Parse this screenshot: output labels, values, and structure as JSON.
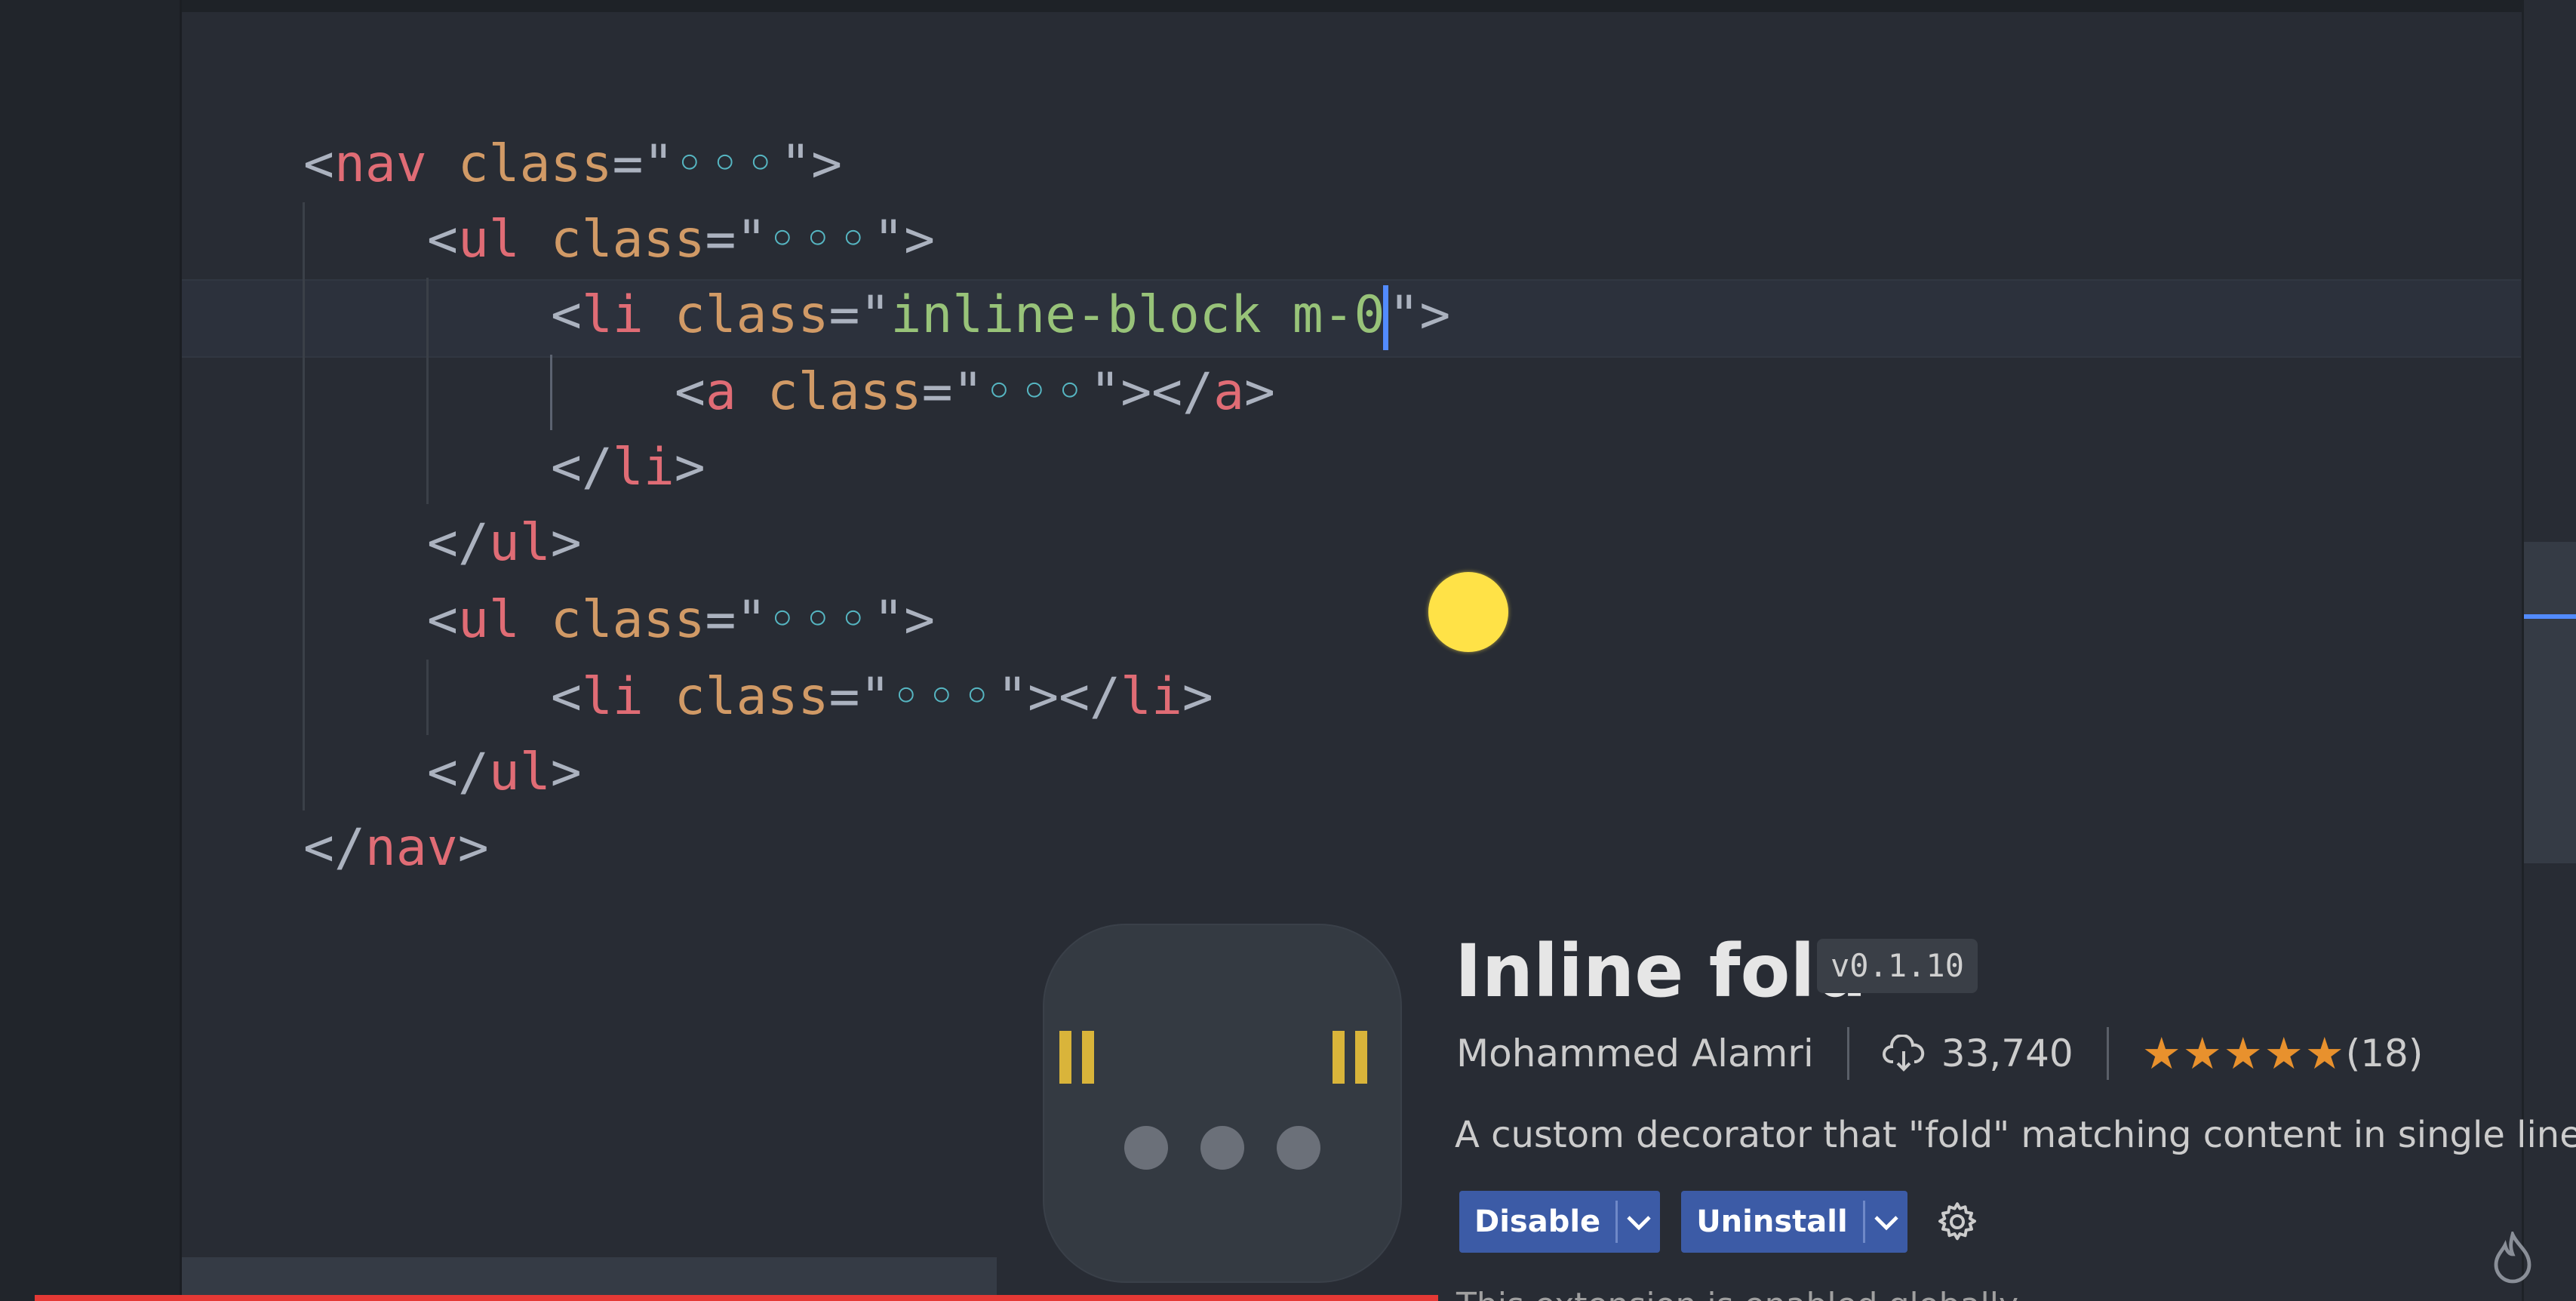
{
  "editor": {
    "lines": [
      {
        "open": "<",
        "tag": "nav",
        "attr": "class",
        "eq": "=\"",
        "value": "◦◦◦",
        "close": "\">"
      },
      {
        "open": "<",
        "tag": "ul",
        "attr": "class",
        "eq": "=\"",
        "value": "◦◦◦",
        "close": "\">"
      },
      {
        "open": "<",
        "tag": "li",
        "attr": "class",
        "eq": "=\"",
        "value": "inline-block m-0",
        "close": "\">"
      },
      {
        "open": "<",
        "tag": "a",
        "attr": "class",
        "eq": "=\"",
        "value": "◦◦◦",
        "close": "\">",
        "endOpen": "</",
        "endTag": "a",
        "endClose": ">"
      },
      {
        "open": "</",
        "tag": "li",
        "close": ">"
      },
      {
        "open": "</",
        "tag": "ul",
        "close": ">"
      },
      {
        "open": "<",
        "tag": "ul",
        "attr": "class",
        "eq": "=\"",
        "value": "◦◦◦",
        "close": "\">"
      },
      {
        "open": "<",
        "tag": "li",
        "attr": "class",
        "eq": "=\"",
        "value": "◦◦◦",
        "close": "\">",
        "endOpen": "</",
        "endTag": "li",
        "endClose": ">"
      },
      {
        "open": "</",
        "tag": "ul",
        "close": ">"
      },
      {
        "open": "</",
        "tag": "nav",
        "close": ">"
      }
    ]
  },
  "extension": {
    "title": "Inline fold",
    "version": "v0.1.10",
    "author": "Mohammed Alamri",
    "downloads": "33,740",
    "stars": "★★★★★",
    "rating_count": "(18)",
    "description": "A custom decorator that \"fold\" matching content in single line",
    "disable_label": "Disable",
    "uninstall_label": "Uninstall",
    "status_text": "This extension is enabled globally."
  },
  "colors": {
    "background": "#282c34",
    "tag": "#e06c75",
    "attribute": "#d19a66",
    "string": "#98c379",
    "cursor": "#528bff",
    "button": "#3c5ba6",
    "stars": "#e8912d",
    "mouse_indicator": "#ffe247"
  },
  "icons": {
    "download": "cloud-download-icon",
    "settings": "gear-icon",
    "dropdown": "chevron-down-icon",
    "flame": "flame-icon"
  }
}
